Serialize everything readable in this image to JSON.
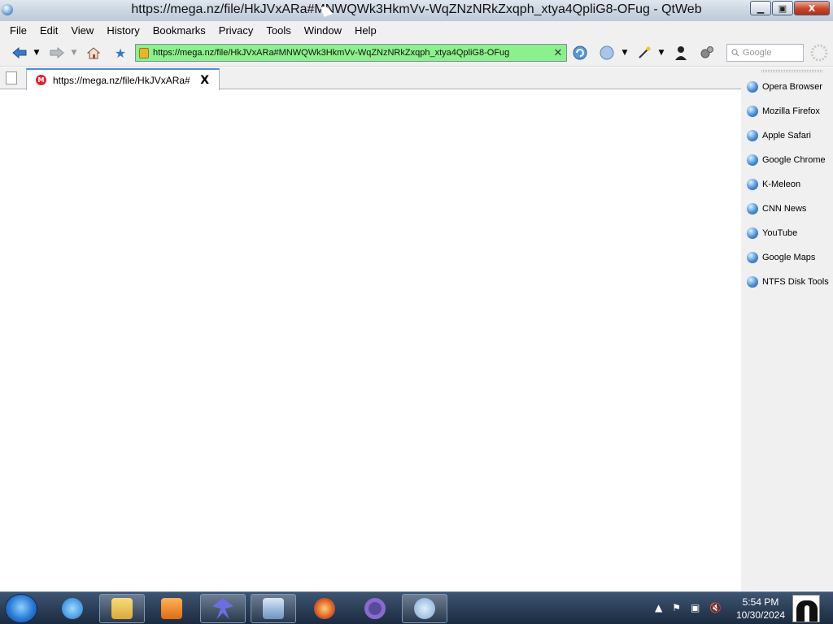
{
  "window": {
    "title": "https://mega.nz/file/HkJVxARa#MNWQWk3HkmVv-WqZNzNRkZxqph_xtya4QpliG8-OFug - QtWeb",
    "controls": {
      "minimize": "▁",
      "maximize": "▣",
      "close": "X"
    }
  },
  "menu": {
    "items": [
      "File",
      "Edit",
      "View",
      "History",
      "Bookmarks",
      "Privacy",
      "Tools",
      "Window",
      "Help"
    ]
  },
  "toolbar": {
    "url": "https://mega.nz/file/HkJVxARa#MNWQWk3HkmVv-WqZNzNRkZxqph_xtya4QpliG8-OFug",
    "url_clear": "✕",
    "search_placeholder": "Google",
    "icons": [
      "back-icon",
      "back-dropdown-icon",
      "forward-icon",
      "forward-dropdown-icon",
      "home-icon",
      "bookmark-star-icon",
      "reload-icon",
      "globe-icon",
      "globe-dropdown-icon",
      "magic-wand-icon",
      "wand-dropdown-icon",
      "privacy-agent-icon",
      "settings-gears-icon",
      "progress-spinner-icon"
    ]
  },
  "tabs": [
    {
      "title": "https://mega.nz/file/HkJVxARa#...",
      "favicon": "M",
      "close": "X"
    }
  ],
  "sidebar": {
    "items": [
      {
        "label": "Opera Browser"
      },
      {
        "label": "Mozilla Firefox"
      },
      {
        "label": "Apple Safari"
      },
      {
        "label": "Google Chrome"
      },
      {
        "label": "K-Meleon"
      },
      {
        "label": "CNN News"
      },
      {
        "label": "YouTube"
      },
      {
        "label": "Google Maps"
      },
      {
        "label": "NTFS Disk Tools"
      }
    ]
  },
  "taskbar": {
    "apps": [
      "internet-explorer-icon",
      "file-explorer-icon",
      "media-player-icon",
      "app-bird-icon",
      "control-panel-icon",
      "browser-icon",
      "circle-app-icon",
      "qtweb-icon"
    ],
    "clock_time": "5:54 PM",
    "clock_date": "10/30/2024",
    "colors": {
      "accent": "#4d8ce0",
      "url_bg": "#8cf08c"
    }
  }
}
